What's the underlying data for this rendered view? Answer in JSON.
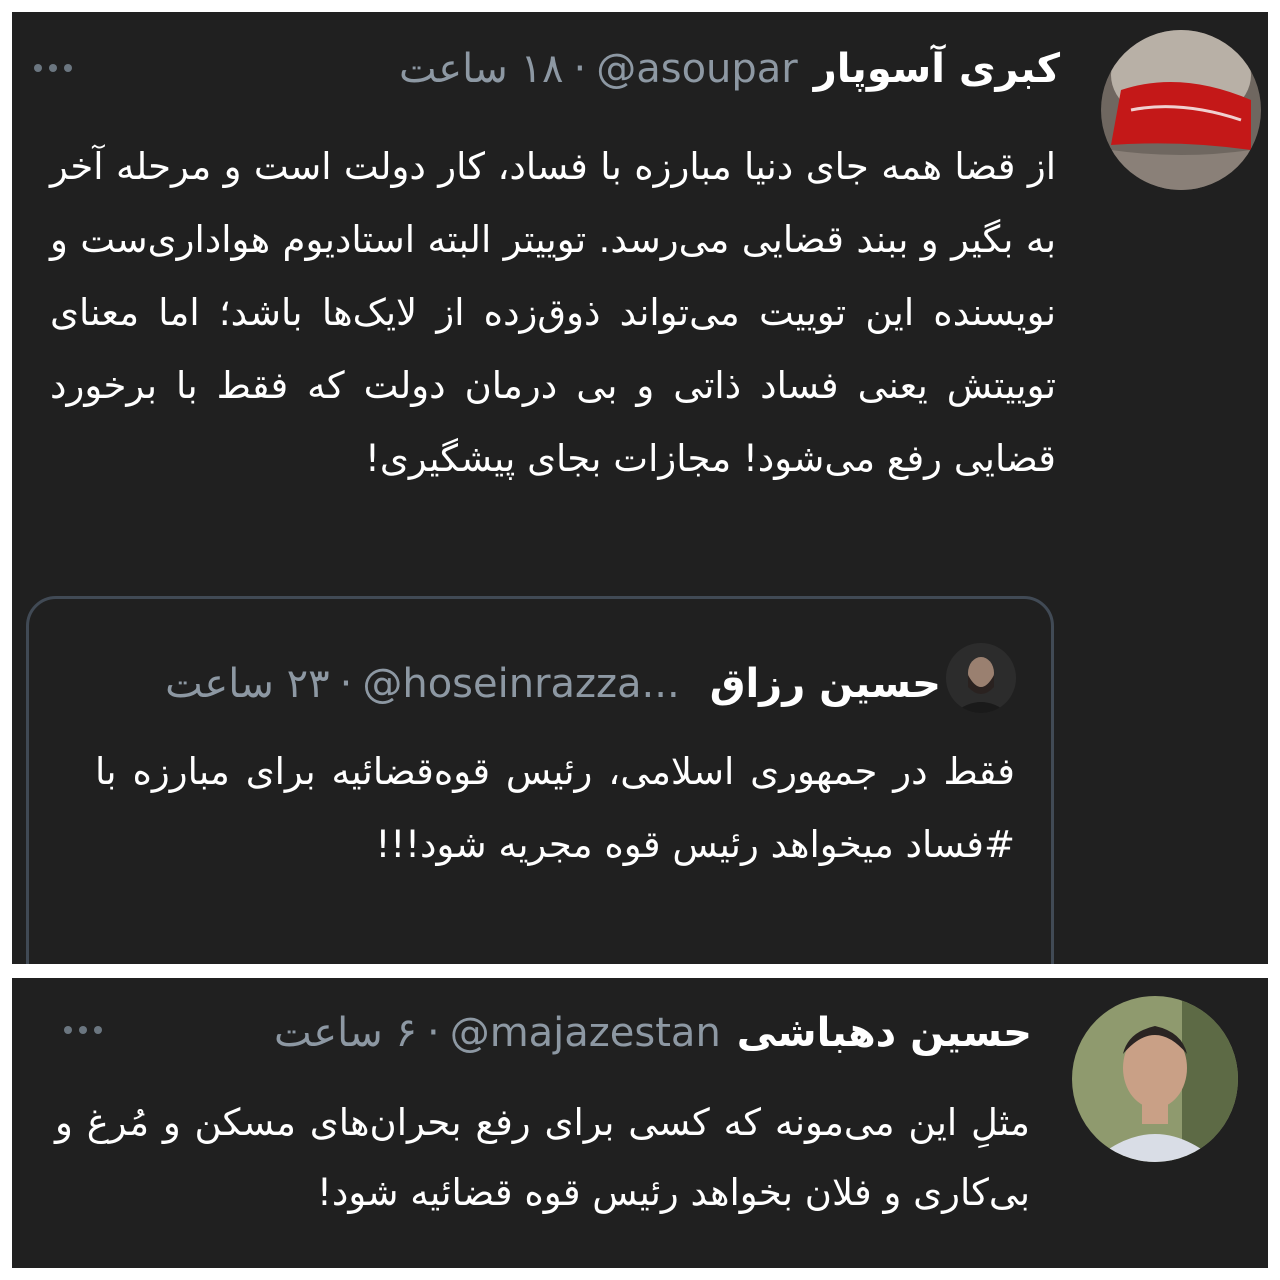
{
  "tweet1": {
    "name": "کبری آسوپار",
    "handle": "@asoupar",
    "separator": "·",
    "time": "۱۸ ساعت",
    "text": "از قضا همه جای دنیا مبارزه با فساد، کار دولت است و مرحله آخر به بگیر و ببند قضایی می‌رسد. توییتر البته استادیوم هواداری‌ست و نویسنده این توییت می‌تواند ذوق‌زده از لایک‌ها باشد؛ اما معنای توییتش یعنی فساد ذاتی و بی درمان دولت که فقط با برخورد قضایی رفع می‌شود! مجازات بجای پیشگیری!",
    "avatar_icon": "avatar-red-wristband",
    "more_icon": "more-options-icon"
  },
  "quote": {
    "name": "حسین رزاق",
    "handle": "@hoseinrazza...",
    "separator": "·",
    "time": "۲۳ ساعت",
    "text": "فقط در جمهوری اسلامی، رئیس قوه‌قضائیه برای مبارزه با #فساد میخواهد رئیس قوه مجریه شود!!!",
    "avatar_icon": "avatar-man-beard"
  },
  "tweet2": {
    "name": "حسین دهباشی",
    "handle": "@majazestan",
    "separator": "·",
    "time": "۶ ساعت",
    "text": "مثلِ این می‌مونه که کسی برای رفع بحران‌های مسکن و مُرغ و بی‌کاری و فلان بخواهد رئیس قوه قضائیه شود!",
    "avatar_icon": "avatar-man-portrait",
    "more_icon": "more-options-icon"
  },
  "colors": {
    "background": "#202020",
    "text": "#ffffff",
    "muted": "#8d98a3",
    "quote_border": "#414a55",
    "page": "#ffffff"
  }
}
